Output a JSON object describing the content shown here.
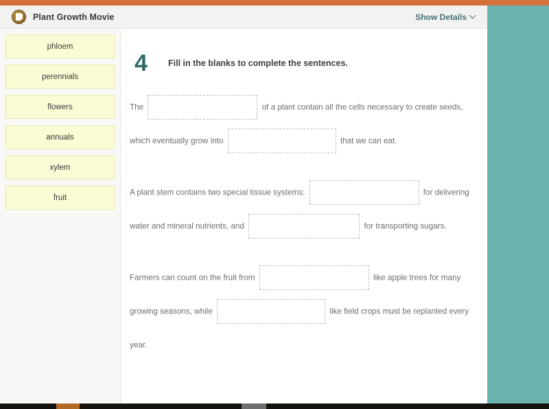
{
  "header": {
    "app_title": "Plant Growth Movie",
    "app_icon": "movie-badge-icon",
    "show_details_label": "Show Details",
    "chevron_icon": "chevron-down-icon",
    "bar_color": "#d4703c",
    "background_color": "#f2f2f1"
  },
  "word_bank": {
    "tiles": [
      {
        "label": "phloem"
      },
      {
        "label": "perennials"
      },
      {
        "label": "flowers"
      },
      {
        "label": "annuals"
      },
      {
        "label": "xylem"
      },
      {
        "label": "fruit"
      }
    ],
    "tile_fill": "#fbfbd5",
    "tile_border": "#e8e8aa"
  },
  "question": {
    "number": "4",
    "number_color": "#2f6a63",
    "prompt": "Fill in the blanks to complete the sentences.",
    "sentences": [
      {
        "id": "sentence-1",
        "parts": [
          {
            "type": "text",
            "value": "The"
          },
          {
            "type": "blank",
            "value": "",
            "name": "blank-1"
          },
          {
            "type": "text",
            "value": "of a plant contain all the cells necessary to create seeds,"
          },
          {
            "type": "text",
            "value": "which eventually grow into"
          },
          {
            "type": "blank",
            "value": "",
            "name": "blank-2"
          },
          {
            "type": "text",
            "value": "that we can eat."
          }
        ]
      },
      {
        "id": "sentence-2",
        "parts": [
          {
            "type": "text",
            "value": "A plant stem contains two special tissue systems:"
          },
          {
            "type": "blank",
            "value": "",
            "name": "blank-3"
          },
          {
            "type": "text",
            "value": "for"
          },
          {
            "type": "text",
            "value": "delivering water and mineral nutrients, and"
          },
          {
            "type": "blank",
            "value": "",
            "name": "blank-4"
          },
          {
            "type": "text",
            "value": "for transporting"
          },
          {
            "type": "text",
            "value": "sugars."
          }
        ]
      },
      {
        "id": "sentence-3",
        "parts": [
          {
            "type": "text",
            "value": "Farmers can count on the fruit from"
          },
          {
            "type": "blank",
            "value": "",
            "name": "blank-5"
          },
          {
            "type": "text",
            "value": "like apple trees for many"
          },
          {
            "type": "text",
            "value": "growing seasons, while"
          },
          {
            "type": "blank",
            "value": "",
            "name": "blank-6"
          },
          {
            "type": "text",
            "value": "like field crops must be replanted"
          },
          {
            "type": "text",
            "value": "every year."
          }
        ]
      }
    ]
  },
  "panels": {
    "right_panel_color": "#6cb3b0",
    "bottom_strip_color": "#16130f"
  }
}
